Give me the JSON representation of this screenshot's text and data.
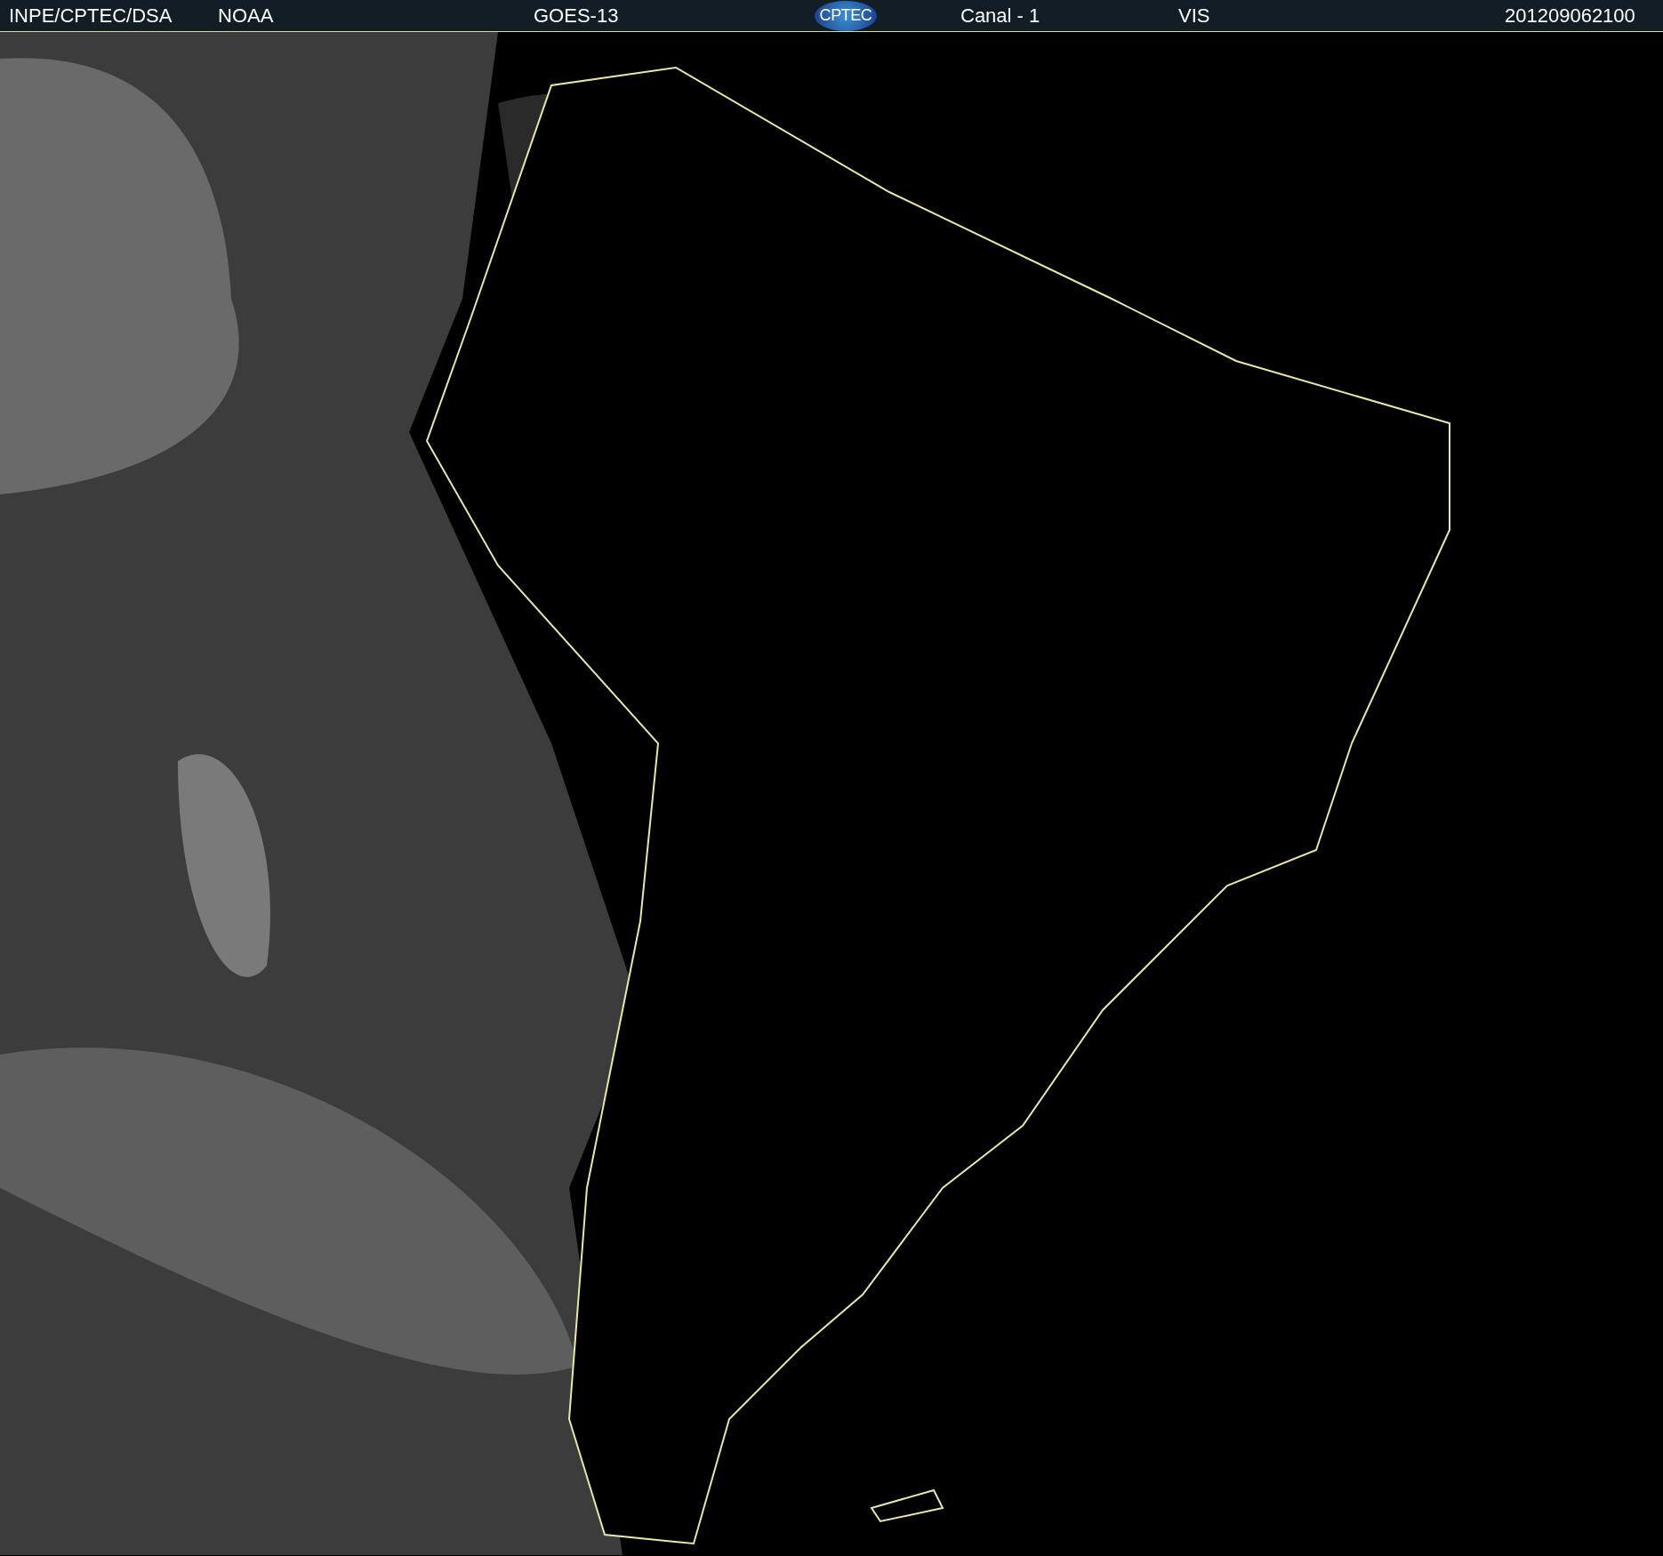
{
  "header": {
    "source": "INPE/CPTEC/DSA",
    "agency": "NOAA",
    "satellite": "GOES-13",
    "logo": "CPTEC",
    "channel": "Canal - 1",
    "band": "VIS",
    "timestamp": "201209062100"
  }
}
